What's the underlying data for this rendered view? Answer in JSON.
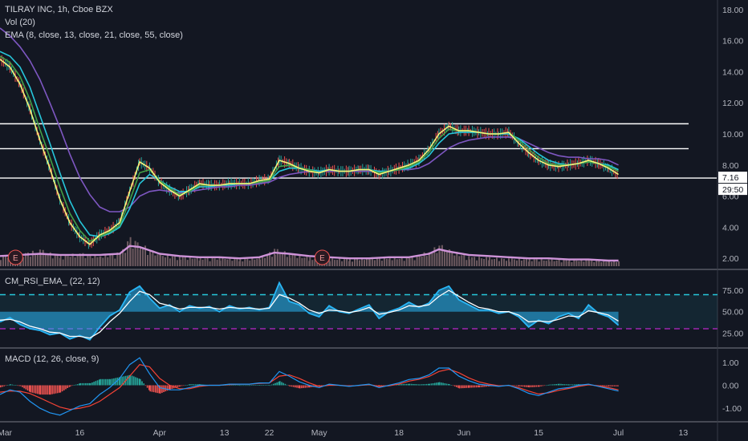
{
  "legend": {
    "main": "TILRAY INC, 1h, Cboe BZX",
    "vol": "Vol (20)",
    "ema": "EMA (8, close, 13, close, 21, close, 55, close)",
    "rsi": "CM_RSI_EMA_ (22, 12)",
    "macd": "MACD (12, 26, close, 9)"
  },
  "price_label": "7.16",
  "countdown_label": "29:50",
  "earnings_marker": "E",
  "colors": {
    "background": "#131722",
    "ema8": "#f5f57a",
    "ema13": "#43a047",
    "ema21": "#26c6da",
    "ema55": "#7e57c2",
    "volume": "#6e5a60",
    "volume_ema": "#ce93d8",
    "rsi_line": "#29b6f6",
    "rsi_signal": "#ffffff",
    "rsi_band": "#26c6da",
    "rsi_lower": "#9c27b0",
    "macd_line": "#2196f3",
    "signal_line": "#f44336",
    "hist_up": "#26a69a",
    "hist_down": "#ef5350",
    "hline": "#ffffff"
  },
  "chart_data": [
    {
      "type": "line",
      "panel": "price",
      "x_ticks": [
        "Mar",
        "16",
        "Apr",
        "13",
        "22",
        "May",
        "18",
        "Jun",
        "15",
        "Jul",
        "13"
      ],
      "x_tick_pos": [
        0,
        16,
        32,
        45,
        54,
        64,
        80,
        93,
        108,
        124,
        137
      ],
      "x_range": [
        0,
        140
      ],
      "y_ticks": [
        "18.00",
        "16.00",
        "14.00",
        "12.00",
        "10.00",
        "8.00",
        "6.00",
        "4.00",
        "2.00"
      ],
      "y_tick_values": [
        18,
        16,
        14,
        12,
        10,
        8,
        6,
        4,
        2
      ],
      "ylim": [
        1.6,
        18.4
      ],
      "horizontal_lines": [
        10.65,
        9.05,
        7.16
      ],
      "series": [
        {
          "key": "ema8",
          "x": [
            0,
            2,
            4,
            6,
            8,
            10,
            12,
            14,
            16,
            18,
            20,
            22,
            24,
            26,
            28,
            30,
            32,
            34,
            36,
            38,
            40,
            42,
            44,
            46,
            48,
            50,
            52,
            54,
            56,
            58,
            60,
            62,
            64,
            66,
            68,
            70,
            72,
            74,
            76,
            78,
            80,
            82,
            84,
            86,
            88,
            90,
            92,
            94,
            96,
            98,
            100,
            102,
            104,
            106,
            108,
            110,
            112,
            114,
            116,
            118,
            120,
            122,
            124
          ],
          "values": [
            14.8,
            14.3,
            13.2,
            11.6,
            9.6,
            7.8,
            5.8,
            4.3,
            3.4,
            2.9,
            3.5,
            3.8,
            4.3,
            6.3,
            8.2,
            7.8,
            6.9,
            6.4,
            6.0,
            6.4,
            6.8,
            6.7,
            6.7,
            6.8,
            6.8,
            6.8,
            7.0,
            7.1,
            8.3,
            8.1,
            7.8,
            7.6,
            7.5,
            7.7,
            7.6,
            7.6,
            7.7,
            7.7,
            7.4,
            7.6,
            7.8,
            8.0,
            8.3,
            9.0,
            10.0,
            10.5,
            10.2,
            10.2,
            10.1,
            10.0,
            10.0,
            10.1,
            9.4,
            8.8,
            8.3,
            8.0,
            7.9,
            8.0,
            8.1,
            8.3,
            8.1,
            7.8,
            7.4
          ]
        },
        {
          "key": "ema13",
          "x": [
            0,
            2,
            4,
            6,
            8,
            10,
            12,
            14,
            16,
            18,
            20,
            22,
            24,
            26,
            28,
            30,
            32,
            34,
            36,
            38,
            40,
            42,
            44,
            46,
            48,
            50,
            52,
            54,
            56,
            58,
            60,
            62,
            64,
            66,
            68,
            70,
            72,
            74,
            76,
            78,
            80,
            82,
            84,
            86,
            88,
            90,
            92,
            94,
            96,
            98,
            100,
            102,
            104,
            106,
            108,
            110,
            112,
            114,
            116,
            118,
            120,
            122,
            124
          ],
          "values": [
            15.0,
            14.6,
            13.7,
            12.2,
            10.3,
            8.5,
            6.6,
            4.9,
            3.8,
            3.1,
            3.4,
            3.7,
            4.1,
            5.7,
            7.5,
            7.7,
            7.0,
            6.5,
            6.1,
            6.3,
            6.7,
            6.7,
            6.7,
            6.8,
            6.8,
            6.8,
            6.9,
            7.0,
            7.9,
            8.0,
            7.8,
            7.7,
            7.5,
            7.7,
            7.6,
            7.6,
            7.7,
            7.7,
            7.5,
            7.6,
            7.7,
            7.9,
            8.2,
            8.8,
            9.7,
            10.3,
            10.2,
            10.2,
            10.1,
            10.0,
            10.0,
            10.1,
            9.6,
            9.0,
            8.5,
            8.1,
            8.0,
            8.0,
            8.1,
            8.2,
            8.1,
            7.9,
            7.6
          ]
        },
        {
          "key": "ema21",
          "x": [
            0,
            2,
            4,
            6,
            8,
            10,
            12,
            14,
            16,
            18,
            20,
            22,
            24,
            26,
            28,
            30,
            32,
            34,
            36,
            38,
            40,
            42,
            44,
            46,
            48,
            50,
            52,
            54,
            56,
            58,
            60,
            62,
            64,
            66,
            68,
            70,
            72,
            74,
            76,
            78,
            80,
            82,
            84,
            86,
            88,
            90,
            92,
            94,
            96,
            98,
            100,
            102,
            104,
            106,
            108,
            110,
            112,
            114,
            116,
            118,
            120,
            122,
            124
          ],
          "values": [
            15.3,
            15.0,
            14.3,
            13.0,
            11.2,
            9.4,
            7.5,
            5.7,
            4.4,
            3.5,
            3.4,
            3.6,
            4.0,
            5.2,
            6.8,
            7.4,
            7.0,
            6.6,
            6.3,
            6.3,
            6.6,
            6.6,
            6.7,
            6.7,
            6.8,
            6.8,
            6.9,
            7.0,
            7.6,
            7.8,
            7.8,
            7.7,
            7.6,
            7.7,
            7.6,
            7.6,
            7.7,
            7.7,
            7.6,
            7.6,
            7.7,
            7.8,
            8.1,
            8.6,
            9.4,
            10.0,
            10.1,
            10.1,
            10.1,
            10.0,
            10.0,
            10.0,
            9.7,
            9.2,
            8.7,
            8.3,
            8.1,
            8.0,
            8.1,
            8.2,
            8.1,
            8.0,
            7.7
          ]
        },
        {
          "key": "ema55",
          "x": [
            0,
            2,
            4,
            6,
            8,
            10,
            12,
            14,
            16,
            18,
            20,
            22,
            24,
            26,
            28,
            30,
            32,
            34,
            36,
            38,
            40,
            42,
            44,
            46,
            48,
            50,
            52,
            54,
            56,
            58,
            60,
            62,
            64,
            66,
            68,
            70,
            72,
            74,
            76,
            78,
            80,
            82,
            84,
            86,
            88,
            90,
            92,
            94,
            96,
            98,
            100,
            102,
            104,
            106,
            108,
            110,
            112,
            114,
            116,
            118,
            120,
            122,
            124
          ],
          "values": [
            16.8,
            16.3,
            15.6,
            14.7,
            13.5,
            12.0,
            10.4,
            8.7,
            7.2,
            6.1,
            5.3,
            5.0,
            5.0,
            5.3,
            6.0,
            6.3,
            6.4,
            6.3,
            6.2,
            6.3,
            6.4,
            6.5,
            6.6,
            6.6,
            6.7,
            6.7,
            6.8,
            6.9,
            7.2,
            7.4,
            7.5,
            7.6,
            7.6,
            7.6,
            7.6,
            7.6,
            7.6,
            7.6,
            7.6,
            7.6,
            7.7,
            7.7,
            7.8,
            8.1,
            8.6,
            9.1,
            9.4,
            9.6,
            9.7,
            9.8,
            9.8,
            9.8,
            9.7,
            9.4,
            9.1,
            8.8,
            8.6,
            8.5,
            8.5,
            8.4,
            8.4,
            8.3,
            8.0
          ]
        }
      ],
      "volume": {
        "x": [
          0,
          4,
          8,
          12,
          16,
          20,
          24,
          26,
          28,
          30,
          32,
          36,
          40,
          44,
          48,
          52,
          55,
          58,
          62,
          66,
          70,
          74,
          78,
          82,
          86,
          88,
          90,
          94,
          98,
          102,
          106,
          110,
          114,
          118,
          122,
          124
        ],
        "values": [
          1.0,
          1.2,
          1.5,
          1.0,
          1.2,
          1.0,
          1.3,
          2.6,
          2.2,
          1.5,
          1.1,
          0.9,
          0.8,
          0.8,
          0.7,
          0.8,
          1.6,
          1.2,
          0.8,
          0.7,
          0.7,
          0.8,
          0.8,
          0.8,
          1.4,
          2.0,
          1.5,
          0.9,
          0.8,
          0.7,
          0.7,
          0.6,
          0.6,
          0.6,
          0.5,
          0.5
        ],
        "ema": [
          0.9,
          1.0,
          1.1,
          1.0,
          1.0,
          1.0,
          1.1,
          1.8,
          1.7,
          1.4,
          1.1,
          0.9,
          0.8,
          0.8,
          0.7,
          0.8,
          1.2,
          1.1,
          0.9,
          0.8,
          0.7,
          0.7,
          0.8,
          0.8,
          1.1,
          1.5,
          1.3,
          1.0,
          0.9,
          0.8,
          0.7,
          0.7,
          0.6,
          0.6,
          0.5,
          0.5
        ],
        "earnings_x": [
          1.5,
          63
        ]
      }
    },
    {
      "type": "line",
      "panel": "rsi",
      "y_ticks": [
        "75.00",
        "50.00",
        "25.00"
      ],
      "y_tick_values": [
        75,
        50,
        25
      ],
      "ylim": [
        13,
        93
      ],
      "band": [
        70,
        30
      ],
      "x": [
        0,
        2,
        4,
        6,
        8,
        10,
        12,
        14,
        16,
        18,
        20,
        22,
        24,
        26,
        28,
        30,
        32,
        34,
        36,
        38,
        40,
        42,
        44,
        46,
        48,
        50,
        52,
        54,
        56,
        58,
        60,
        62,
        64,
        66,
        68,
        70,
        72,
        74,
        76,
        78,
        80,
        82,
        84,
        86,
        88,
        90,
        92,
        94,
        96,
        98,
        100,
        102,
        104,
        106,
        108,
        110,
        112,
        114,
        116,
        118,
        120,
        122,
        124
      ],
      "rsi": [
        38,
        43,
        35,
        30,
        28,
        23,
        25,
        18,
        22,
        17,
        32,
        45,
        52,
        73,
        80,
        66,
        54,
        58,
        50,
        57,
        54,
        56,
        50,
        57,
        53,
        55,
        52,
        55,
        84,
        62,
        58,
        48,
        44,
        57,
        50,
        48,
        53,
        58,
        42,
        50,
        54,
        61,
        55,
        60,
        75,
        80,
        64,
        58,
        52,
        52,
        48,
        50,
        44,
        32,
        40,
        36,
        44,
        48,
        42,
        58,
        48,
        44,
        34
      ],
      "signal": [
        40,
        41,
        38,
        33,
        30,
        26,
        25,
        21,
        21,
        19,
        26,
        38,
        48,
        62,
        74,
        70,
        60,
        57,
        53,
        55,
        55,
        55,
        53,
        55,
        54,
        54,
        53,
        54,
        70,
        66,
        60,
        52,
        48,
        52,
        51,
        49,
        51,
        55,
        47,
        49,
        52,
        57,
        56,
        58,
        68,
        75,
        68,
        61,
        55,
        53,
        50,
        50,
        46,
        38,
        39,
        38,
        41,
        45,
        44,
        51,
        49,
        46,
        39
      ]
    },
    {
      "type": "line",
      "panel": "macd",
      "y_ticks": [
        "1.00",
        "0.00",
        "-1.00"
      ],
      "y_tick_values": [
        1,
        0,
        -1
      ],
      "ylim": [
        -1.45,
        1.45
      ],
      "x": [
        0,
        2,
        4,
        6,
        8,
        10,
        12,
        14,
        16,
        18,
        20,
        22,
        24,
        26,
        28,
        30,
        32,
        34,
        36,
        38,
        40,
        42,
        44,
        46,
        48,
        50,
        52,
        54,
        56,
        58,
        60,
        62,
        64,
        66,
        68,
        70,
        72,
        74,
        76,
        78,
        80,
        82,
        84,
        86,
        88,
        90,
        92,
        94,
        96,
        98,
        100,
        102,
        104,
        106,
        108,
        110,
        112,
        114,
        116,
        118,
        120,
        122,
        124
      ],
      "macd": [
        -0.4,
        -0.2,
        -0.3,
        -0.7,
        -1.0,
        -1.2,
        -1.3,
        -1.1,
        -0.9,
        -0.8,
        -0.4,
        -0.1,
        0.3,
        0.9,
        1.2,
        0.5,
        -0.1,
        -0.2,
        -0.2,
        -0.1,
        0.0,
        0.0,
        0.0,
        0.05,
        0.05,
        0.05,
        0.1,
        0.1,
        0.6,
        0.4,
        0.15,
        0.0,
        -0.1,
        0.05,
        0.0,
        -0.05,
        0.0,
        0.05,
        -0.1,
        0.0,
        0.1,
        0.25,
        0.3,
        0.45,
        0.75,
        0.75,
        0.4,
        0.2,
        0.05,
        0.0,
        -0.05,
        0.0,
        -0.15,
        -0.35,
        -0.45,
        -0.3,
        -0.15,
        -0.1,
        0.0,
        0.05,
        -0.05,
        -0.15,
        -0.25
      ],
      "signal": [
        -0.3,
        -0.25,
        -0.26,
        -0.36,
        -0.55,
        -0.75,
        -0.95,
        -1.05,
        -1.0,
        -0.9,
        -0.7,
        -0.4,
        -0.1,
        0.4,
        0.9,
        0.8,
        0.3,
        0.0,
        -0.15,
        -0.15,
        -0.05,
        0.0,
        0.0,
        0.03,
        0.05,
        0.05,
        0.08,
        0.1,
        0.4,
        0.45,
        0.3,
        0.1,
        -0.05,
        0.0,
        0.0,
        -0.03,
        -0.01,
        0.03,
        -0.05,
        -0.02,
        0.05,
        0.18,
        0.26,
        0.38,
        0.6,
        0.7,
        0.55,
        0.32,
        0.15,
        0.05,
        -0.02,
        -0.01,
        -0.1,
        -0.25,
        -0.38,
        -0.33,
        -0.22,
        -0.14,
        -0.05,
        0.02,
        -0.02,
        -0.1,
        -0.2
      ]
    }
  ]
}
